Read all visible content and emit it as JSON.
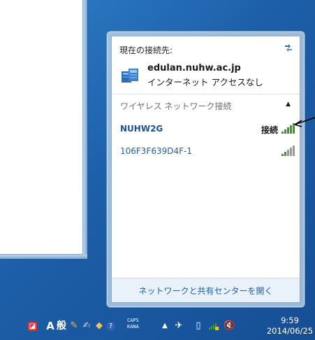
{
  "popup": {
    "current_label": "現在の接続先:",
    "network_name": "edulan.nuhw.ac.jp",
    "network_status": "インターネット アクセスなし",
    "wireless_label": "ワイヤレス ネットワーク接続",
    "wifi": [
      {
        "name": "NUHW2G",
        "status": "接続",
        "signal_bars": 5
      },
      {
        "name": "106F3F639D4F-1",
        "status": "",
        "signal_bars": 5
      }
    ],
    "footer_link": "ネットワークと共有センターを開く"
  },
  "taskbar": {
    "ime_mode": "A",
    "ime_label": "般",
    "caps": "CAPS",
    "kana": "KANA",
    "time": "9:59",
    "date": "2014/06/25"
  },
  "colors": {
    "accent": "#1f5fa6",
    "signal_green": "#3c9a28"
  }
}
